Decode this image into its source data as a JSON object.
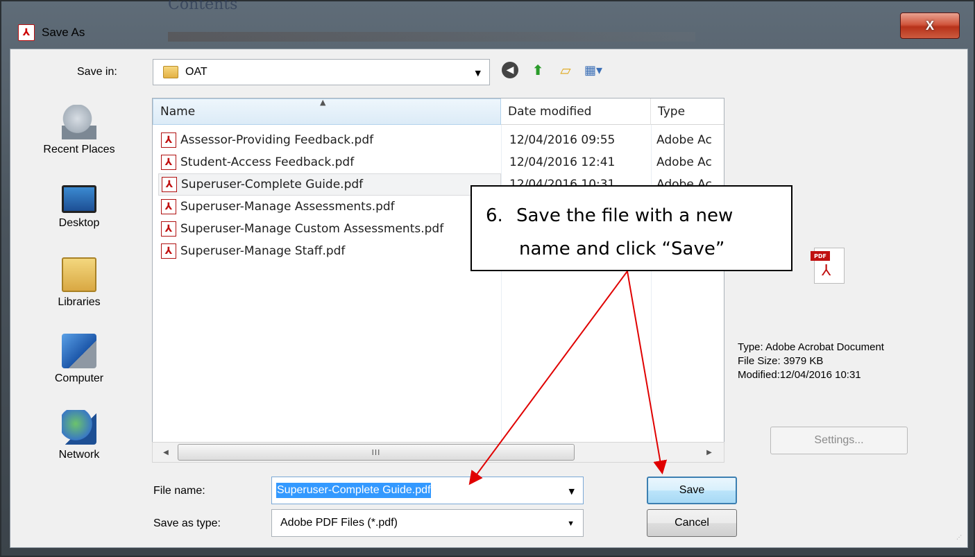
{
  "background_doc": {
    "title": "Contents"
  },
  "window": {
    "title": "Save As",
    "close_glyph": "X"
  },
  "toolbar": {
    "save_in_label": "Save in:",
    "save_in_value": "OAT",
    "icons": [
      "back-icon",
      "up-folder-icon",
      "new-folder-icon",
      "views-menu-icon"
    ]
  },
  "places": [
    {
      "label": "Recent Places",
      "icon": "recent-places-icon"
    },
    {
      "label": "Desktop",
      "icon": "desktop-icon"
    },
    {
      "label": "Libraries",
      "icon": "libraries-icon"
    },
    {
      "label": "Computer",
      "icon": "computer-icon"
    },
    {
      "label": "Network",
      "icon": "network-icon"
    }
  ],
  "columns": {
    "name": "Name",
    "date": "Date modified",
    "type": "Type"
  },
  "files": [
    {
      "name": "Assessor-Providing Feedback.pdf",
      "date": "12/04/2016 09:55",
      "type": "Adobe Ac"
    },
    {
      "name": "Student-Access Feedback.pdf",
      "date": "12/04/2016 12:41",
      "type": "Adobe Ac"
    },
    {
      "name": "Superuser-Complete Guide.pdf",
      "date": "12/04/2016 10:31",
      "type": "Adobe Ac",
      "selected": true
    },
    {
      "name": "Superuser-Manage Assessments.pdf",
      "date": "",
      "type": ""
    },
    {
      "name": "Superuser-Manage Custom Assessments.pdf",
      "date": "",
      "type": ""
    },
    {
      "name": "Superuser-Manage Staff.pdf",
      "date": "",
      "type": ""
    }
  ],
  "scrollbar": {
    "thumb_grip": "III"
  },
  "preview": {
    "icon_tag": "PDF",
    "type_line": "Type: Adobe Acrobat Document",
    "size_line": "File Size: 3979 KB",
    "modified_line": "Modified:12/04/2016 10:31"
  },
  "settings_button": "Settings...",
  "form": {
    "file_name_label": "File name:",
    "file_name_value": "Superuser-Complete Guide.pdf",
    "save_as_type_label": "Save as type:",
    "save_as_type_value": "Adobe PDF Files (*.pdf)"
  },
  "buttons": {
    "save": "Save",
    "cancel": "Cancel"
  },
  "callout": {
    "number": "6.",
    "line1": "Save the file with a new",
    "line2": "name and click “Save”"
  },
  "colors": {
    "annotation_arrow": "#e00000",
    "selection": "#3399ff",
    "close_button": "#c74a2f"
  }
}
